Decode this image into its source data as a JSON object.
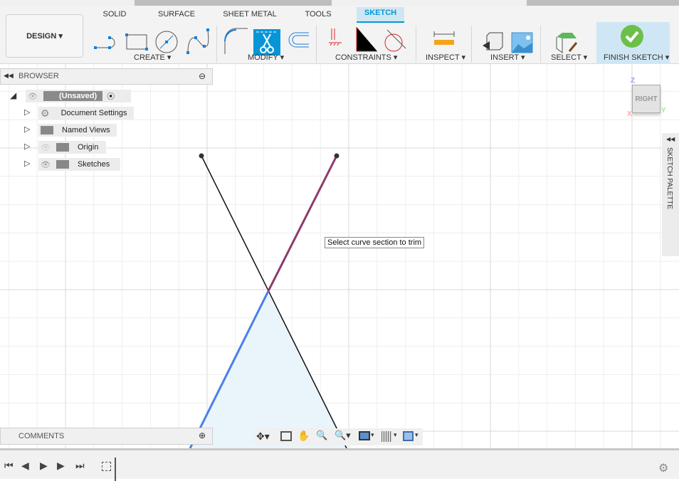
{
  "workspace": {
    "label": "DESIGN"
  },
  "tabs": [
    {
      "label": "SOLID"
    },
    {
      "label": "SURFACE"
    },
    {
      "label": "SHEET METAL"
    },
    {
      "label": "TOOLS"
    },
    {
      "label": "SKETCH",
      "active": true
    }
  ],
  "groups": {
    "create": "CREATE",
    "modify": "MODIFY",
    "constraints": "CONSTRAINTS",
    "inspect": "INSPECT",
    "insert": "INSERT",
    "select": "SELECT",
    "finish": "FINISH SKETCH"
  },
  "browser": {
    "title": "BROWSER",
    "root": "(Unsaved)",
    "items": [
      {
        "label": "Document Settings"
      },
      {
        "label": "Named Views"
      },
      {
        "label": "Origin"
      },
      {
        "label": "Sketches"
      }
    ]
  },
  "comments": {
    "title": "COMMENTS"
  },
  "tooltip": "Select curve section to trim",
  "viewcube": {
    "face": "RIGHT",
    "z": "Z",
    "y": "Y",
    "x": "X"
  },
  "palette": {
    "label": "SKETCH PALETTE"
  },
  "colors": {
    "accent": "#0696d7",
    "finish": "#6cc04a",
    "selected_line": "#8e3a6e",
    "blue_line": "#4a7ee8",
    "fill": "#eaf4fb"
  }
}
